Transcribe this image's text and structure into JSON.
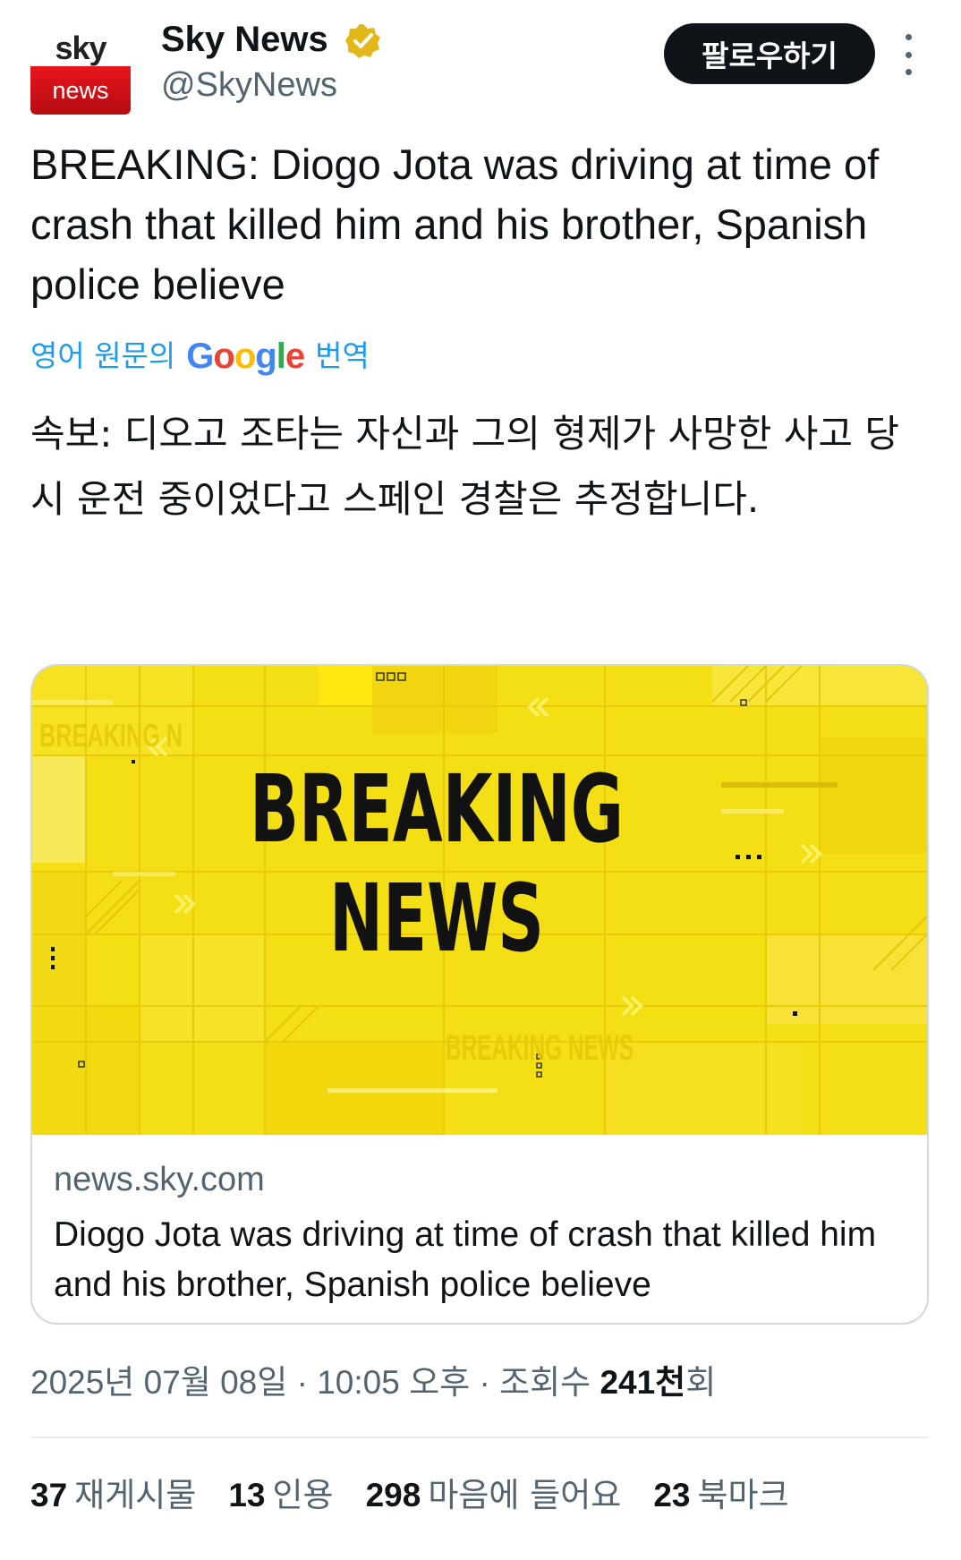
{
  "author": {
    "name": "Sky News",
    "handle": "@SkyNews",
    "avatar_top": "sky",
    "avatar_bottom": "news"
  },
  "follow_label": "팔로우하기",
  "tweet_text_en": "BREAKING: Diogo Jota was driving at time of crash that killed him and his brother, Spanish police believe",
  "translate": {
    "prefix": "영어 원문의",
    "suffix": "번역"
  },
  "tweet_text_ko": "속보: 디오고 조타는 자신과 그의 형제가 사망한 사고 당시 운전 중이었다고 스페인 경찰은 추정합니다.",
  "card": {
    "image_line1": "BREAKING",
    "image_line2": "NEWS",
    "image_watermark1": "BREAKING N",
    "image_watermark2": "BREAKING NEWS",
    "domain": "news.sky.com",
    "title": "Diogo Jota was driving at time of crash that killed him and his brother, Spanish police believe"
  },
  "meta": {
    "date": "2025년 07월 08일",
    "time": "10:05 오후",
    "views_label": "조회수",
    "views_count": "241천",
    "views_suffix": "회"
  },
  "stats": {
    "retweets_count": "37",
    "retweets_label": "재게시물",
    "quotes_count": "13",
    "quotes_label": "인용",
    "likes_count": "298",
    "likes_label": "마음에 들어요",
    "bookmarks_count": "23",
    "bookmarks_label": "북마크"
  },
  "colors": {
    "accent": "#1d9bf0",
    "card_yellow": "#f3dd12",
    "sky_red": "#e8141c"
  }
}
